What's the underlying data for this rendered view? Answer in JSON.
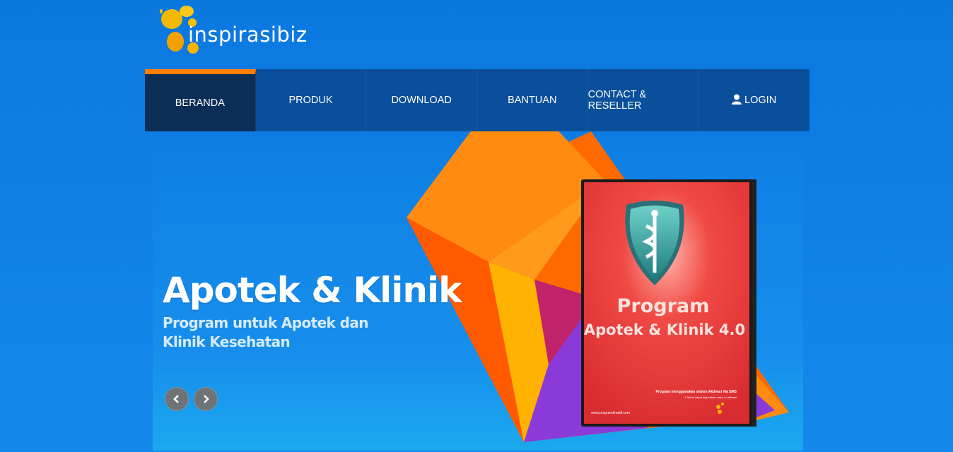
{
  "brand": {
    "name": "inspirasibiz"
  },
  "nav": {
    "items": [
      {
        "label": "BERANDA",
        "active": true
      },
      {
        "label": "PRODUK"
      },
      {
        "label": "DOWNLOAD"
      },
      {
        "label": "BANTUAN"
      },
      {
        "label": "CONTACT & RESELLER"
      },
      {
        "label": "LOGIN",
        "icon": "user-icon"
      }
    ]
  },
  "hero": {
    "title": "Apotek & Klinik",
    "subtitle": "Program untuk Apotek dan Klinik Kesehatan",
    "box": {
      "title_line1": "Program",
      "title_line2": "Apotek & Klinik 4.0",
      "note_line1": "Program menggunakan sistem Aktivasi Via SMS",
      "note_line2": "1 Serial dapat digunakan untuk in aktivasi",
      "url": "www.programkreatif.com"
    },
    "prev_icon": "chevron-left-icon",
    "next_icon": "chevron-right-icon"
  },
  "colors": {
    "accent": "#ff7f00",
    "nav_active": "#0c2d55",
    "background": "#0b78df",
    "box_red": "#e8343a"
  }
}
